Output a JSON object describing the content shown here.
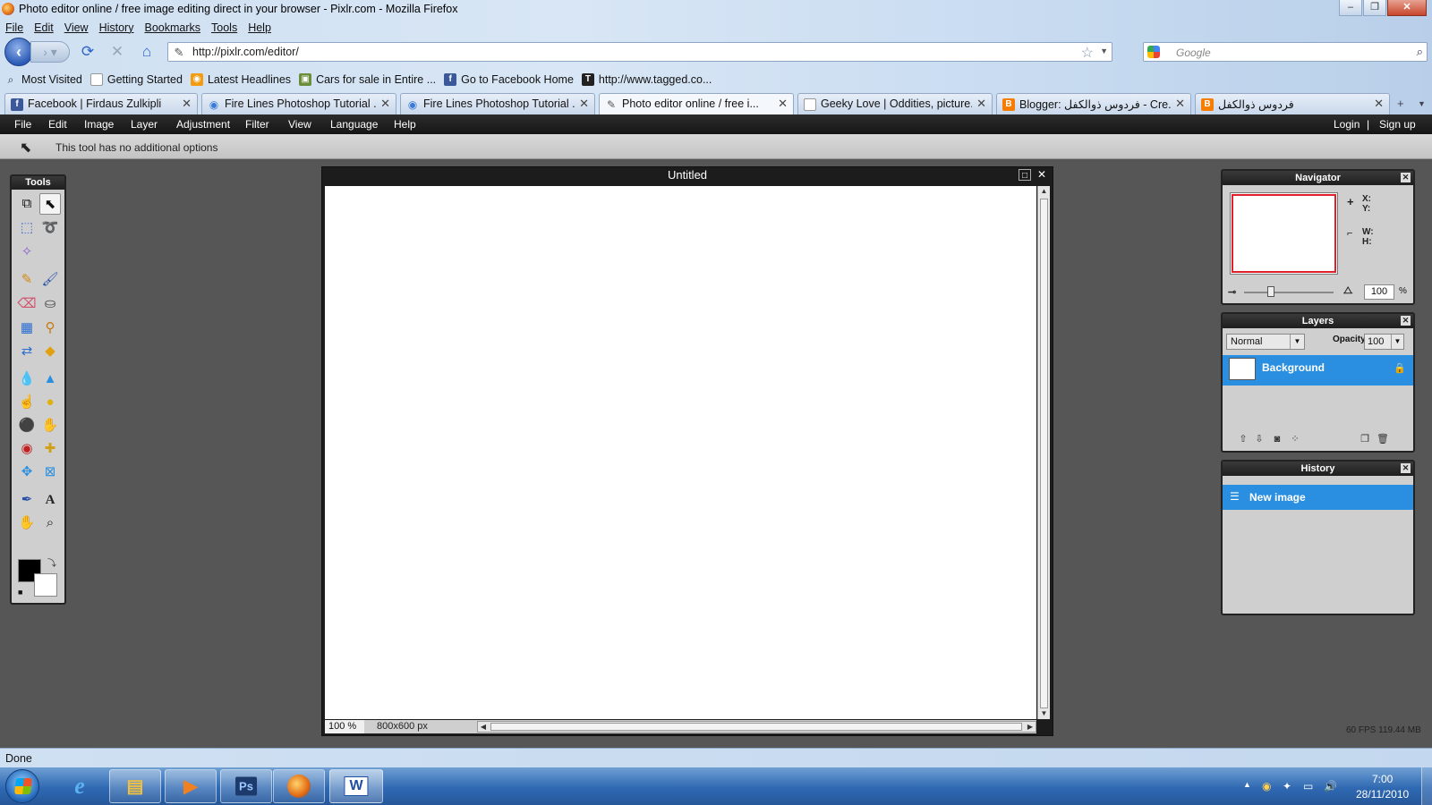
{
  "window": {
    "title": "Photo editor online / free image editing direct in your browser - Pixlr.com - Mozilla Firefox"
  },
  "firefox_menu": [
    "File",
    "Edit",
    "View",
    "History",
    "Bookmarks",
    "Tools",
    "Help"
  ],
  "address": {
    "url": "http://pixlr.com/editor/",
    "search_placeholder": "Google"
  },
  "bookmarks": [
    {
      "label": "Most Visited",
      "icon": "most-visited-icon"
    },
    {
      "label": "Getting Started",
      "icon": "page-icon"
    },
    {
      "label": "Latest Headlines",
      "icon": "rss-icon"
    },
    {
      "label": "Cars for sale in Entire ...",
      "icon": "site-icon"
    },
    {
      "label": "Go to Facebook Home",
      "icon": "facebook-icon"
    },
    {
      "label": "http://www.tagged.co...",
      "icon": "tagged-icon"
    }
  ],
  "tabs": [
    {
      "label": "Facebook | Firdaus Zulkipli",
      "icon": "facebook-icon",
      "active": false
    },
    {
      "label": "Fire Lines Photoshop Tutorial ...",
      "icon": "eye-icon",
      "active": false
    },
    {
      "label": "Fire Lines Photoshop Tutorial ...",
      "icon": "eye-icon",
      "active": false
    },
    {
      "label": "Photo editor online / free i...",
      "icon": "pixlr-icon",
      "active": true
    },
    {
      "label": "Geeky Love | Oddities, picture...",
      "icon": "page-icon",
      "active": false
    },
    {
      "label": "Blogger: فردوس ذوالكفل - Cre...",
      "icon": "blogger-icon",
      "active": false
    },
    {
      "label": "فردوس ذوالكفل",
      "icon": "blogger-icon",
      "active": false
    }
  ],
  "app_menu": [
    "File",
    "Edit",
    "Image",
    "Layer",
    "Adjustment",
    "Filter",
    "View",
    "Language",
    "Help"
  ],
  "auth": {
    "login": "Login",
    "separator": "|",
    "signup": "Sign up"
  },
  "options_bar": {
    "text": "This tool has no additional options"
  },
  "tools_panel": {
    "title": "Tools"
  },
  "document": {
    "title": "Untitled",
    "zoom": "100 %",
    "size": "800x600 px"
  },
  "navigator": {
    "title": "Navigator",
    "x_label": "X:",
    "y_label": "Y:",
    "w_label": "W:",
    "h_label": "H:",
    "zoom_value": "100",
    "zoom_unit": "%",
    "zoom_level": 100
  },
  "layers": {
    "title": "Layers",
    "blend_mode": "Normal",
    "opacity_label": "Opacity:",
    "opacity_value": "100",
    "items": [
      {
        "name": "Background",
        "locked": true
      }
    ]
  },
  "history": {
    "title": "History",
    "items": [
      {
        "name": "New image"
      }
    ]
  },
  "perf": {
    "text": "60 FPS 119.44 MB"
  },
  "status_bar": {
    "text": "Done"
  },
  "taskbar": {
    "apps": [
      "internet-explorer-icon",
      "file-explorer-icon",
      "media-player-icon",
      "photoshop-icon",
      "firefox-icon",
      "word-icon"
    ],
    "ps_label": "Ps",
    "word_label": "W",
    "clock_time": "7:00",
    "clock_date": "28/11/2010"
  }
}
